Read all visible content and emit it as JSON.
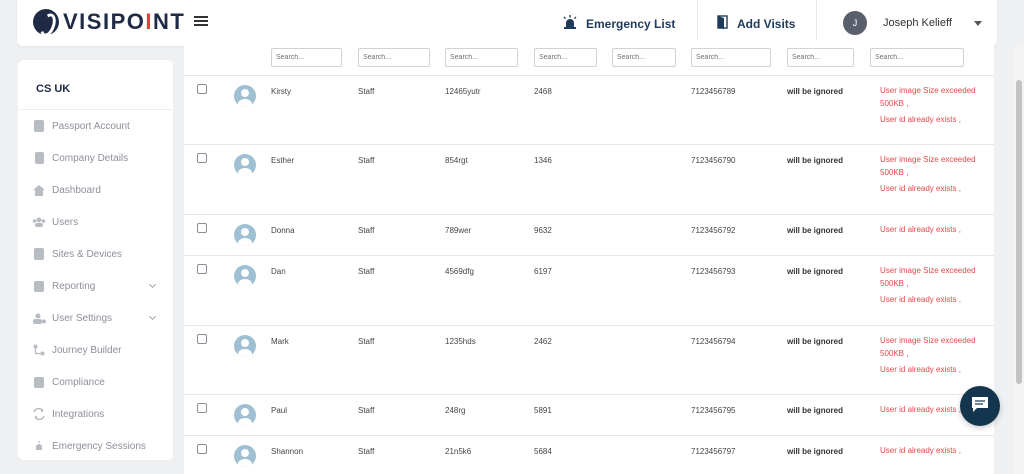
{
  "header": {
    "logo_text_a": "VISIPO",
    "logo_text_b": "I",
    "logo_text_c": "NT",
    "emergency_label": "Emergency List",
    "add_visits_label": "Add Visits",
    "user_initial": "J",
    "user_name": "Joseph Kelieff"
  },
  "sidebar": {
    "org": "CS UK",
    "items": [
      {
        "label": "Passport Account",
        "icon": "passport-icon"
      },
      {
        "label": "Company Details",
        "icon": "building-icon"
      },
      {
        "label": "Dashboard",
        "icon": "home-icon"
      },
      {
        "label": "Users",
        "icon": "users-icon"
      },
      {
        "label": "Sites & Devices",
        "icon": "devices-icon"
      },
      {
        "label": "Reporting",
        "icon": "report-icon"
      },
      {
        "label": "User Settings",
        "icon": "user-settings-icon"
      },
      {
        "label": "Journey Builder",
        "icon": "journey-icon"
      },
      {
        "label": "Compliance",
        "icon": "compliance-icon"
      },
      {
        "label": "Integrations",
        "icon": "integrations-icon"
      },
      {
        "label": "Emergency Sessions",
        "icon": "emergency-icon"
      }
    ]
  },
  "search_placeholder": "Search...",
  "rows": [
    {
      "name": "Kirsty",
      "type": "Staff",
      "id": "12465yutr",
      "code": "2468",
      "phone": "7123456789",
      "status": "will be ignored",
      "err1": "User image Size exceeded 500KB ,",
      "err2": "User id already exists ,"
    },
    {
      "name": "Esther",
      "type": "Staff",
      "id": "854rgt",
      "code": "1346",
      "phone": "7123456790",
      "status": "will be ignored",
      "err1": "User image Size exceeded 500KB ,",
      "err2": "User id already exists ,"
    },
    {
      "name": "Donna",
      "type": "Staff",
      "id": "789wer",
      "code": "9632",
      "phone": "7123456792",
      "status": "will be ignored",
      "err1": "",
      "err2": "User id already exists ,"
    },
    {
      "name": "Dan",
      "type": "Staff",
      "id": "4569dfg",
      "code": "6197",
      "phone": "7123456793",
      "status": "will be ignored",
      "err1": "User image Size exceeded 500KB ,",
      "err2": "User id already exists ,"
    },
    {
      "name": "Mark",
      "type": "Staff",
      "id": "1235hds",
      "code": "2462",
      "phone": "7123456794",
      "status": "will be ignored",
      "err1": "User image Size exceeded 500KB ,",
      "err2": "User id already exists ,"
    },
    {
      "name": "Paul",
      "type": "Staff",
      "id": "248rg",
      "code": "5891",
      "phone": "7123456795",
      "status": "will be ignored",
      "err1": "",
      "err2": "User id already exists ,"
    },
    {
      "name": "Shannon",
      "type": "Staff",
      "id": "21n5k6",
      "code": "5684",
      "phone": "7123456797",
      "status": "will be ignored",
      "err1": "",
      "err2": "User id already exists ,"
    }
  ]
}
